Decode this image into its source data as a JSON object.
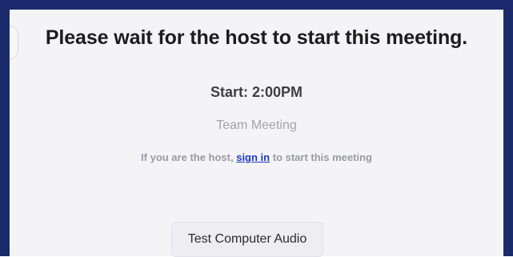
{
  "waiting": {
    "heading": "Please wait for the host to start this meeting.",
    "start_time": "Start: 2:00PM",
    "meeting_name": "Team Meeting",
    "host_prompt_before": "If you are the host, ",
    "sign_in_link": "sign in",
    "host_prompt_after": " to start this meeting"
  },
  "actions": {
    "test_audio_label": "Test Computer Audio"
  },
  "colors": {
    "frame_border": "#1a2a6c",
    "background": "#f4f4f7",
    "link": "#1f39c9"
  }
}
